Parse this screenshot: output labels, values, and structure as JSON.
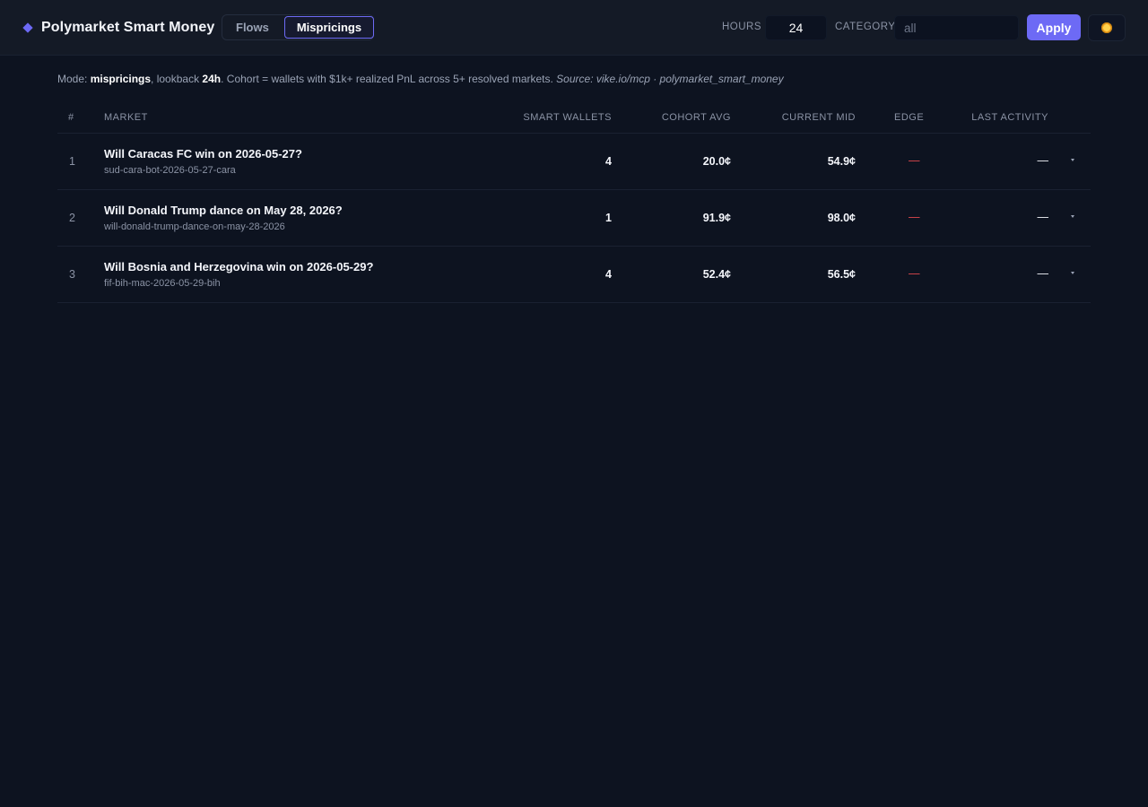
{
  "header": {
    "title": "Polymarket Smart Money",
    "brand_icon": "diamond-icon",
    "tabs": [
      {
        "label": "Flows",
        "active": false
      },
      {
        "label": "Mispricings",
        "active": true
      }
    ],
    "hours_label": "HOURS",
    "hours_value": "24",
    "category_label": "CATEGORY",
    "category_placeholder": "all",
    "category_value": "",
    "apply_label": "Apply",
    "theme_icon": "sun-icon"
  },
  "modeline": {
    "prefix": "Mode: ",
    "mode": "mispricings",
    "lookback_prefix": ", lookback ",
    "lookback": "24h",
    "cohort_text": ". Cohort = wallets with $1k+ realized PnL across 5+ resolved markets. ",
    "source": "Source: vike.io/mcp · polymarket_smart_money"
  },
  "table": {
    "columns": {
      "num": "#",
      "market": "MARKET",
      "wallets": "SMART WALLETS",
      "cohort": "COHORT AVG",
      "mid": "CURRENT MID",
      "edge": "EDGE",
      "activity": "LAST ACTIVITY"
    },
    "rows": [
      {
        "idx": "1",
        "title": "Will Caracas FC win on 2026-05-27?",
        "slug": "sud-cara-bot-2026-05-27-cara",
        "wallets": "4",
        "cohort": "20.0¢",
        "mid": "54.9¢",
        "edge": "—",
        "activity": "—"
      },
      {
        "idx": "2",
        "title": "Will Donald Trump dance on May 28, 2026?",
        "slug": "will-donald-trump-dance-on-may-28-2026",
        "wallets": "1",
        "cohort": "91.9¢",
        "mid": "98.0¢",
        "edge": "—",
        "activity": "—"
      },
      {
        "idx": "3",
        "title": "Will Bosnia and Herzegovina win on 2026-05-29?",
        "slug": "fif-bih-mac-2026-05-29-bih",
        "wallets": "4",
        "cohort": "52.4¢",
        "mid": "56.5¢",
        "edge": "—",
        "activity": "—"
      }
    ]
  },
  "colors": {
    "background": "#0d1320",
    "header_bg": "#141a26",
    "accent": "#6d6af5",
    "edge_negative": "#e0484d"
  }
}
